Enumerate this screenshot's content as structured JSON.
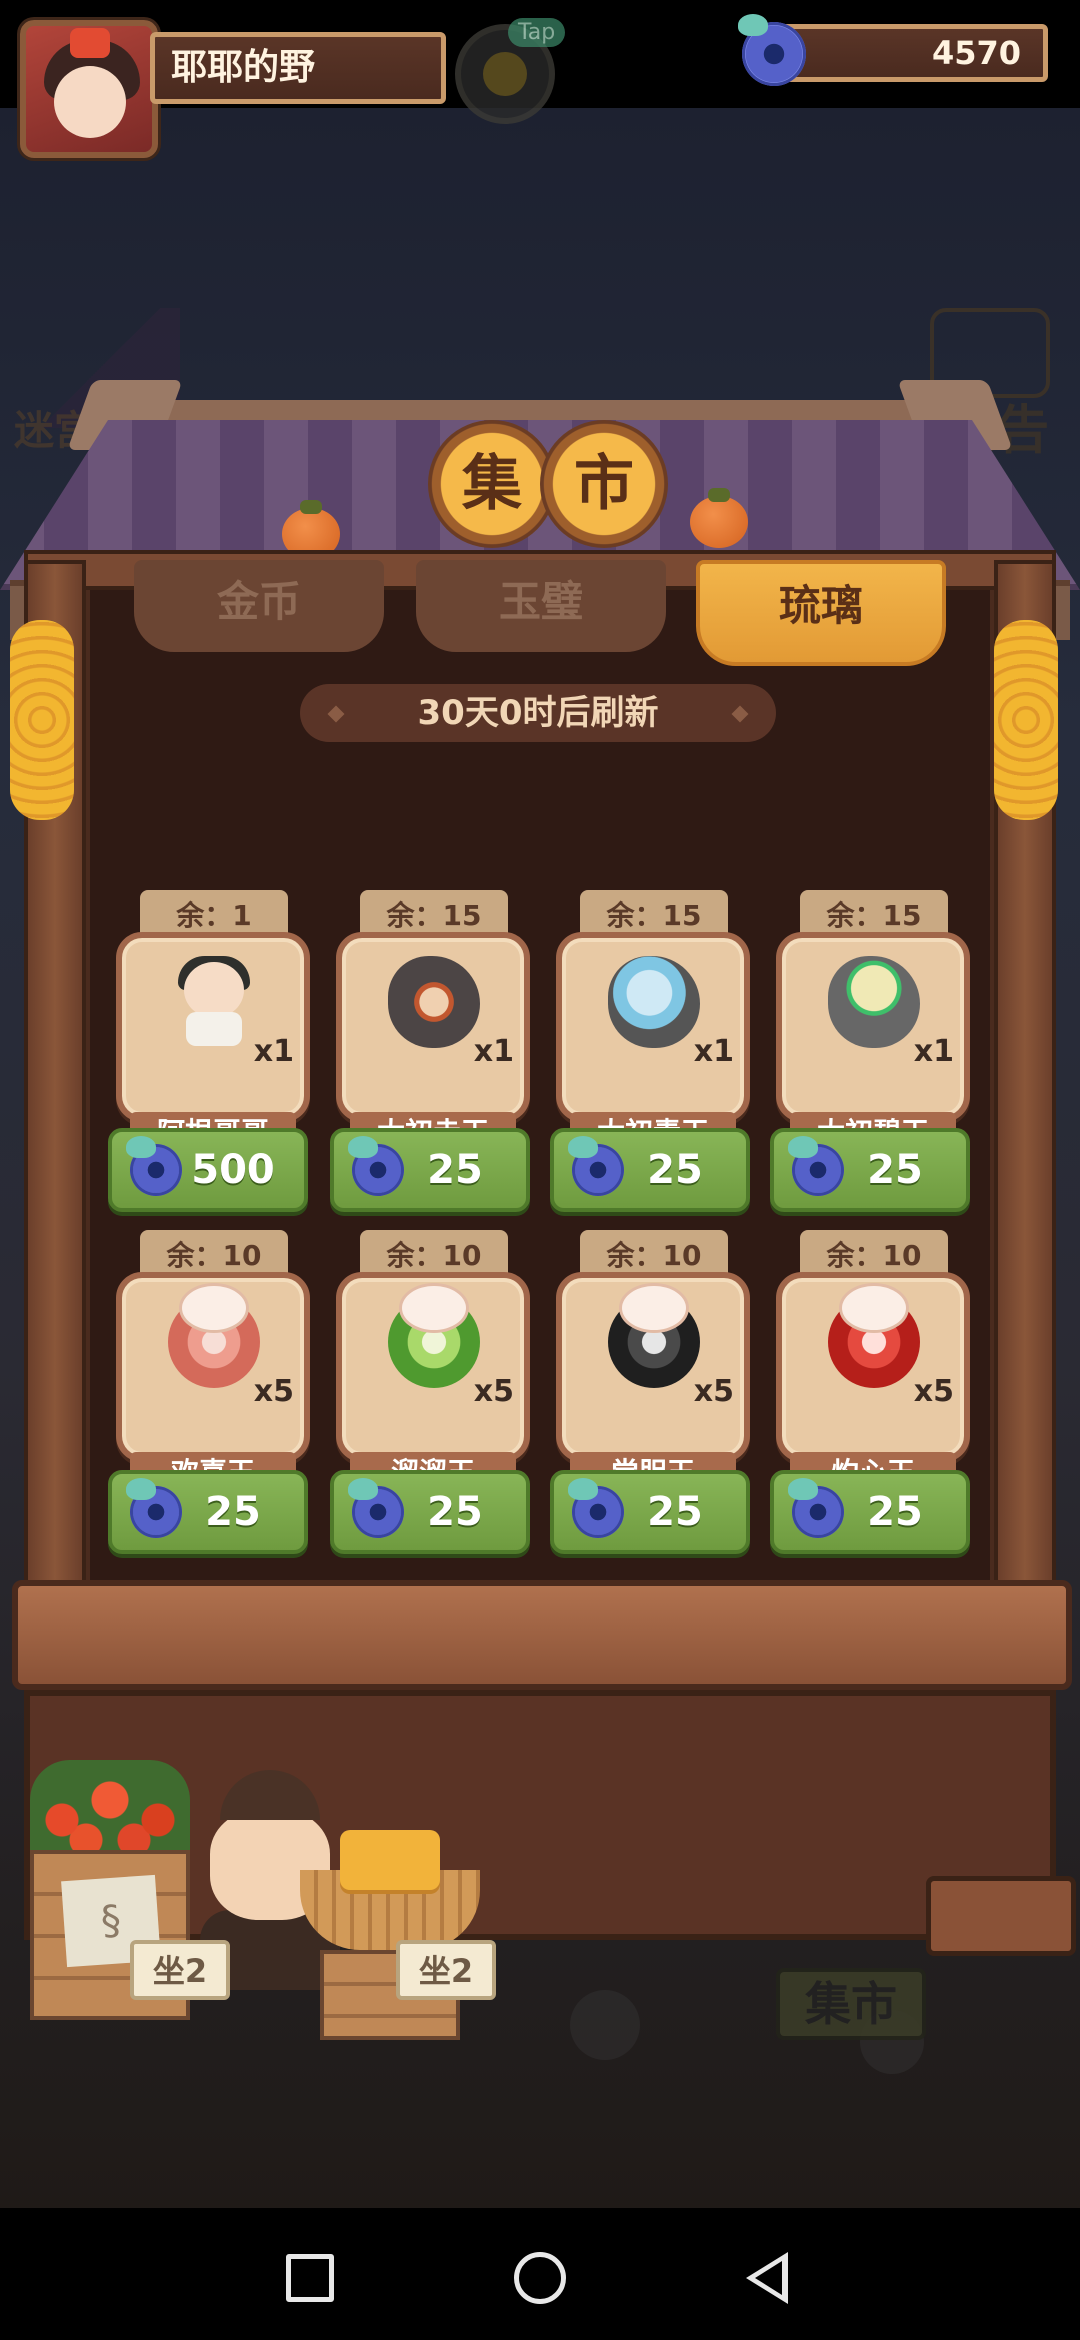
{
  "player": {
    "name": "耶耶的野"
  },
  "hud": {
    "jade_balance": "4570",
    "chat_badge": "Tap"
  },
  "background": {
    "maze_label": "迷宫寻迹",
    "notice_label": "公告",
    "market_sign": "集市",
    "tag_1": "坐2",
    "tag_2": "坐2"
  },
  "title": {
    "char_1": "集",
    "char_2": "市"
  },
  "tabs": [
    {
      "label": "金币",
      "active": false
    },
    {
      "label": "玉璧",
      "active": false
    },
    {
      "label": "琉璃",
      "active": true
    }
  ],
  "refresh_text": "30天0时后刷新",
  "items": [
    {
      "remain": "余：1",
      "name": "阿根哥哥",
      "qty": "x1",
      "price": "500",
      "art": "boy"
    },
    {
      "remain": "余：15",
      "name": "太初赤玉",
      "qty": "x1",
      "price": "25",
      "art": "stone-red"
    },
    {
      "remain": "余：15",
      "name": "太初青玉",
      "qty": "x1",
      "price": "25",
      "art": "stone-blue"
    },
    {
      "remain": "余：15",
      "name": "太初碧玉",
      "qty": "x1",
      "price": "25",
      "art": "stone-green"
    },
    {
      "remain": "余：10",
      "name": "欢喜玉",
      "qty": "x5",
      "price": "25",
      "art": "jade-pink"
    },
    {
      "remain": "余：10",
      "name": "溜溜玉",
      "qty": "x5",
      "price": "25",
      "art": "jade-green"
    },
    {
      "remain": "余：10",
      "name": "尝胆玉",
      "qty": "x5",
      "price": "25",
      "art": "jade-black"
    },
    {
      "remain": "余：10",
      "name": "灼心玉",
      "qty": "x5",
      "price": "25",
      "art": "jade-red"
    }
  ],
  "colors": {
    "active_tab": "#f2b54a",
    "price_button": "#7aa84a",
    "frame": "#a1664a"
  },
  "icons": {
    "currency": "jade-coin-icon"
  }
}
